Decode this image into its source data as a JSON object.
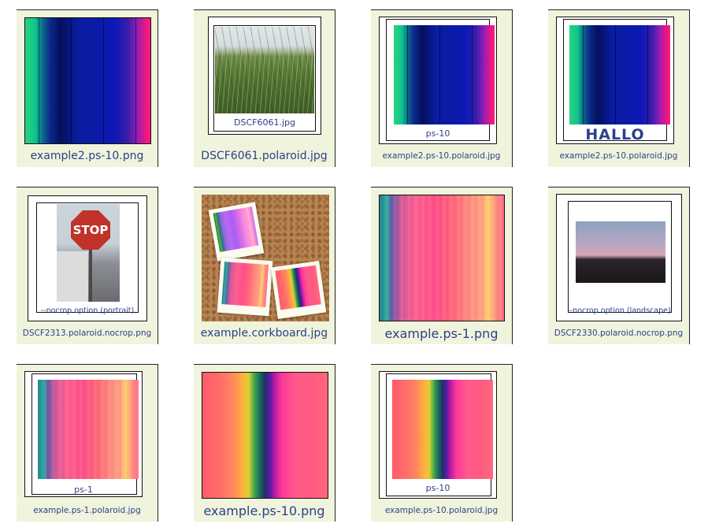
{
  "tiles": [
    {
      "label": "example2.ps-10.png"
    },
    {
      "label": "DSCF6061.polaroid.jpg",
      "caption": "DSCF6061.jpg"
    },
    {
      "label": "example2.ps-10.polaroid.jpg",
      "caption": "ps-10"
    },
    {
      "label": "example2.ps-10.polaroid.jpg",
      "caption": "HALLO"
    },
    {
      "label": "DSCF2313.polaroid.nocrop.png",
      "caption": "--nocrop option (portrait)",
      "sign_text": "STOP"
    },
    {
      "label": "example.corkboard.jpg"
    },
    {
      "label": "example.ps-1.png"
    },
    {
      "label": "DSCF2330.polaroid.nocrop.png",
      "caption": "--nocrop option (landscape)"
    },
    {
      "label": "example.ps-1.polaroid.jpg",
      "caption": "ps-1"
    },
    {
      "label": "example.ps-10.png"
    },
    {
      "label": "example.ps-10.polaroid.jpg",
      "caption": "ps-10"
    }
  ],
  "colors": {
    "tile_bg": "#f0f4dc",
    "label_text": "#2d3f8a"
  }
}
